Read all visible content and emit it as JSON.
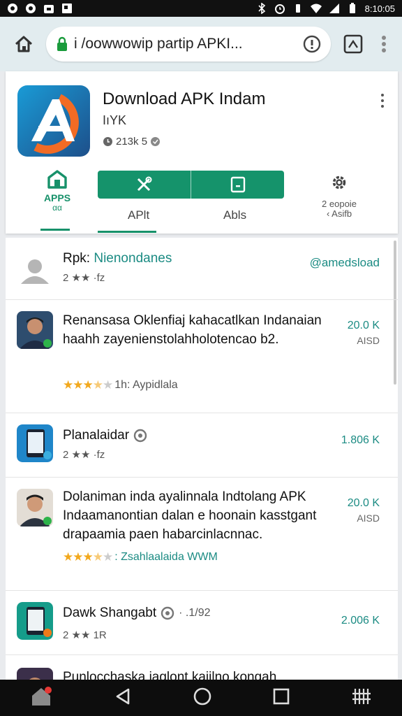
{
  "status_bar": {
    "time": "8:10:05"
  },
  "browser": {
    "url": "i /oowwowip partip APKI..."
  },
  "app": {
    "title": "Download APK Indam",
    "subtitle": "IıYK",
    "meta": "213k 5",
    "tabs": {
      "apps_label": "APPS",
      "apps_sub": "αα",
      "aplt": "APlt",
      "abls": "Abls",
      "settings_line1": "2 eopoie",
      "settings_line2": "‹ Asifb"
    }
  },
  "list": {
    "rows": [
      {
        "title_prefix": "Rpk: ",
        "title_link": "Nienondanes",
        "sub": "2 ★★ ·fz",
        "right": "@amedsload"
      },
      {
        "title": "Renansasa Oklenfiaj kahacatlkan Indanaian haahh zayenienstolahholotencao b2.",
        "stars_filled": 3,
        "stars_half": 1,
        "stars_empty": 1,
        "rating_label": "1h: Aypidlala",
        "right": "20.0 K",
        "right_sub": "AISD"
      },
      {
        "title": "Planalaidar",
        "sub": "2 ★★ ·fz",
        "right": "1.806 K"
      },
      {
        "title": "Dolaniman inda ayalinnala Indtolang APK Indaamanontian dalan e hoonain kasstgant drapaamia paen habarcinlacnnac.",
        "stars_filled": 3,
        "stars_half": 1,
        "stars_empty": 1,
        "rating_label": ": Zsahlaalaida WWM",
        "right": "20.0 K",
        "right_sub": "AISD"
      },
      {
        "title": "Dawk Shangabt",
        "title_suffix": "· .1/92",
        "sub": "2 ★★ 1R",
        "right": "2.006 K"
      },
      {
        "title": "Punlocchaska iaglont kaijlno kongah"
      }
    ]
  },
  "colors": {
    "accent": "#15936b",
    "link": "#1b8b83",
    "star": "#f2a81d"
  }
}
